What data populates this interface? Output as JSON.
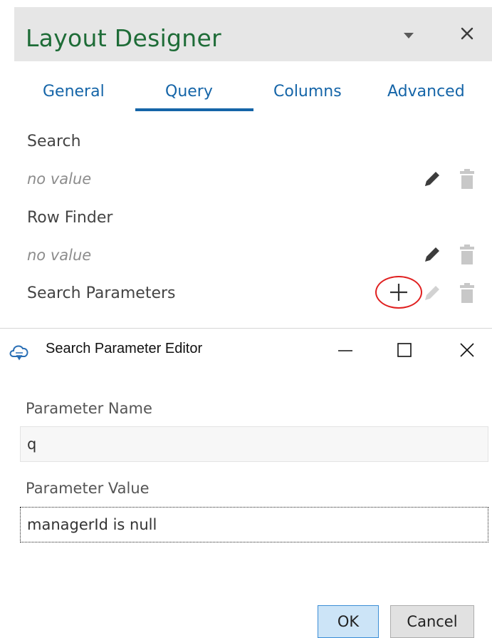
{
  "designer": {
    "title": "Layout Designer",
    "tabs": [
      "General",
      "Query",
      "Columns",
      "Advanced"
    ],
    "active_tab": "Query",
    "sections": {
      "search_label": "Search",
      "search_value": "no value",
      "row_finder_label": "Row Finder",
      "row_finder_value": "no value",
      "search_parameters_label": "Search Parameters"
    }
  },
  "dialog": {
    "title": "Search Parameter Editor",
    "parameter_name_label": "Parameter Name",
    "parameter_name_value": "q",
    "parameter_value_label": "Parameter Value",
    "parameter_value_value": "managerId is null",
    "ok_label": "OK",
    "cancel_label": "Cancel"
  },
  "colors": {
    "title_green": "#1e6c37",
    "tab_blue": "#1565a8",
    "highlight_red": "#e02020",
    "ok_button_bg": "#cce4f7"
  },
  "icons": [
    "chevron-down-icon",
    "close-icon",
    "pencil-icon",
    "trash-icon",
    "plus-icon",
    "cloud-app-icon",
    "minimize-icon",
    "maximize-icon"
  ]
}
